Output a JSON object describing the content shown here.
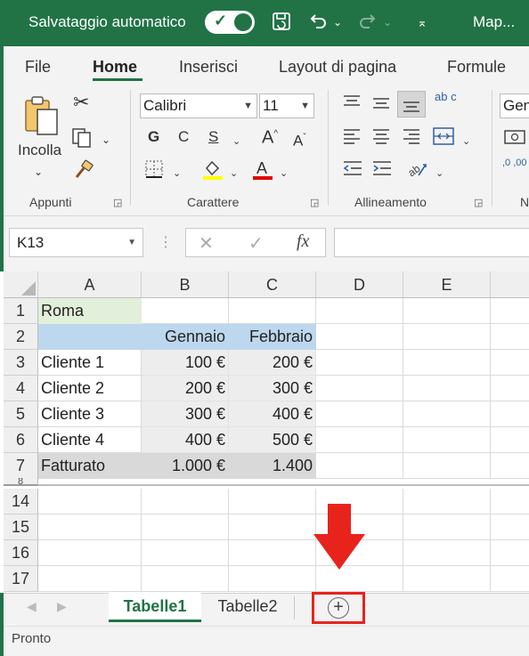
{
  "titlebar": {
    "autosave_label": "Salvataggio automatico",
    "filename": "Map...",
    "accent_color": "#217346"
  },
  "ribbon_tabs": [
    "File",
    "Home",
    "Inserisci",
    "Layout di pagina",
    "Formule"
  ],
  "ribbon": {
    "clipboard": {
      "paste_label": "Incolla",
      "group_label": "Appunti"
    },
    "font": {
      "font_name": "Calibri",
      "font_size": "11",
      "bold": "G",
      "italic": "C",
      "underline": "S",
      "group_label": "Carattere"
    },
    "alignment": {
      "group_label": "Allineamento",
      "wrap_label": "ab c"
    },
    "number": {
      "format_partial": "Gen",
      "group_label_partial": "N",
      "decimals_partial": ",0 ,00"
    }
  },
  "formula_bar": {
    "name_box": "K13",
    "cancel": "✕",
    "enter": "✓",
    "fx": "fx",
    "formula": ""
  },
  "columns": [
    "A",
    "B",
    "C",
    "D",
    "E"
  ],
  "rows": [
    {
      "num": "1",
      "cells": [
        "Roma",
        "",
        ""
      ]
    },
    {
      "num": "2",
      "cells": [
        "",
        "Gennaio",
        "Febbraio"
      ]
    },
    {
      "num": "3",
      "cells": [
        "Cliente 1",
        "100 €",
        "200 €"
      ]
    },
    {
      "num": "4",
      "cells": [
        "Cliente 2",
        "200 €",
        "300 €"
      ]
    },
    {
      "num": "5",
      "cells": [
        "Cliente 3",
        "300 €",
        "400 €"
      ]
    },
    {
      "num": "6",
      "cells": [
        "Cliente 4",
        "400 €",
        "500 €"
      ]
    },
    {
      "num": "7",
      "cells": [
        "Fatturato",
        "1.000 €",
        "1.400"
      ]
    },
    {
      "num": "14",
      "cells": [
        "",
        "",
        ""
      ]
    },
    {
      "num": "15",
      "cells": [
        "",
        "",
        ""
      ]
    },
    {
      "num": "16",
      "cells": [
        "",
        "",
        ""
      ]
    },
    {
      "num": "17",
      "cells": [
        "",
        "",
        ""
      ]
    }
  ],
  "hidden_row_marker": "8",
  "sheets": {
    "tab1": "Tabelle1",
    "tab2": "Tabelle2",
    "add": "+"
  },
  "status": "Pronto",
  "colors": {
    "roma_fill": "#e2efda",
    "header_fill": "#bdd7ee",
    "clients_fill": "#ededed",
    "total_fill": "#d9d9d9",
    "annotation_red": "#e8231c"
  }
}
